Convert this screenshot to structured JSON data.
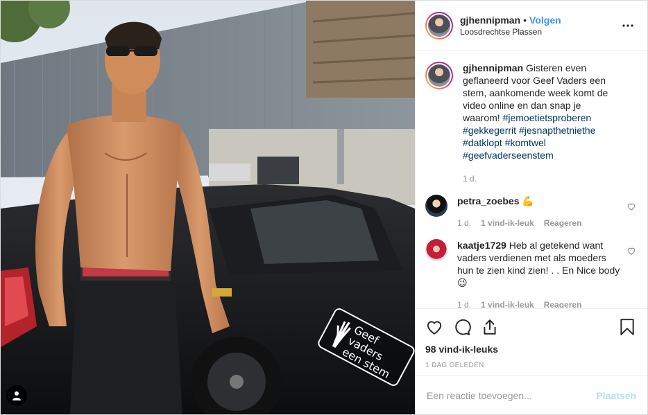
{
  "post": {
    "username": "gjhennipman",
    "follow_label": "Volgen",
    "separator": "•",
    "location": "Loosdrechtse Plassen",
    "sticker_text": "Geef vaders een stem"
  },
  "caption": {
    "username": "gjhennipman",
    "text": "Gisteren even geflaneerd voor Geef Vaders een stem, aankomende week komt de video online en dan snap je waarom!",
    "hashtags": [
      "#jemoetietsproberen",
      "#gekkegerrit",
      "#jesnapthetniethe",
      "#datklopt",
      "#komtwel",
      "#geefvaderseenstem"
    ],
    "time": "1 d."
  },
  "comments": [
    {
      "username": "petra_zoebes",
      "text": "💪",
      "time": "1 d.",
      "likes": "1 vind-ik-leuk",
      "reply_label": "Reageren"
    },
    {
      "username": "kaatje1729",
      "text": "Heb al getekend want vaders verdienen met als moeders hun te zien kind zien! . . En Nice body 😉",
      "time": "1 d.",
      "likes": "1 vind-ik-leuk",
      "reply_label": "Reageren"
    }
  ],
  "footer": {
    "likes": "98 vind-ik-leuks",
    "time_ago": "1 DAG GELEDEN",
    "comment_placeholder": "Een reactie toevoegen...",
    "post_label": "Plaatsen"
  },
  "icons": [
    "more-icon",
    "heart-icon",
    "comment-icon",
    "share-icon",
    "bookmark-icon",
    "user-tag-icon"
  ],
  "colors": {
    "accent": "#3897f0",
    "post_disabled": "#b2dffc",
    "hashtag": "#003569",
    "muted": "#999999"
  }
}
